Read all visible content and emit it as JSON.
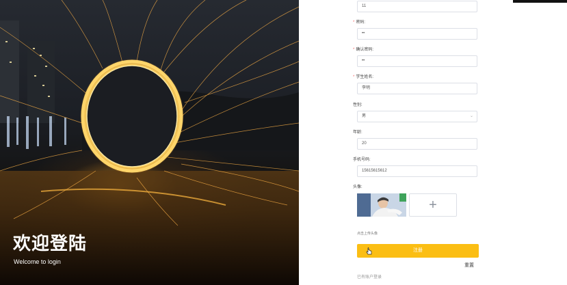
{
  "hero": {
    "title": "欢迎登陆",
    "subtitle": "Welcome to login"
  },
  "form": {
    "username_value": "11",
    "password": {
      "label": "密码:",
      "required": true,
      "value": "••"
    },
    "confirm_password": {
      "label": "确认密码:",
      "required": true,
      "value": "••"
    },
    "student_name": {
      "label": "学生姓名:",
      "required": true,
      "value": "李明"
    },
    "gender": {
      "label": "性别:",
      "value": "男"
    },
    "age": {
      "label": "年龄:",
      "value": "20"
    },
    "phone": {
      "label": "手机号码:",
      "value": "15615615612"
    },
    "avatar": {
      "label": "头像:",
      "hint": "点击上传头像"
    },
    "submit_label": "注册",
    "reset_label": "重置",
    "login_link": "已有账户登录",
    "required_mark": "*"
  },
  "icons": {
    "select_arrow": "chevron-down-icon",
    "upload_plus": "plus-icon",
    "cursor": "hand-pointer-icon"
  },
  "colors": {
    "accent": "#fbbe14",
    "required": "#f56c6c",
    "border": "#dcdfe6"
  }
}
